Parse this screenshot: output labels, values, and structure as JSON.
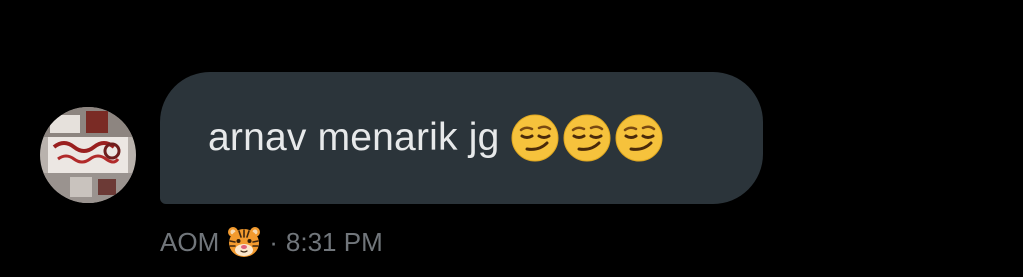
{
  "message": {
    "text": "arnav menarik jg",
    "emojis": [
      "smirking-face",
      "smirking-face",
      "smirking-face"
    ],
    "bubble_color": "#2b343a",
    "text_color": "#e7e9ea"
  },
  "meta": {
    "sender": "AOM",
    "sender_emoji": "tiger-face",
    "separator": "·",
    "time": "8:31 PM",
    "color": "#71767b"
  },
  "theme": {
    "background": "#000000"
  }
}
